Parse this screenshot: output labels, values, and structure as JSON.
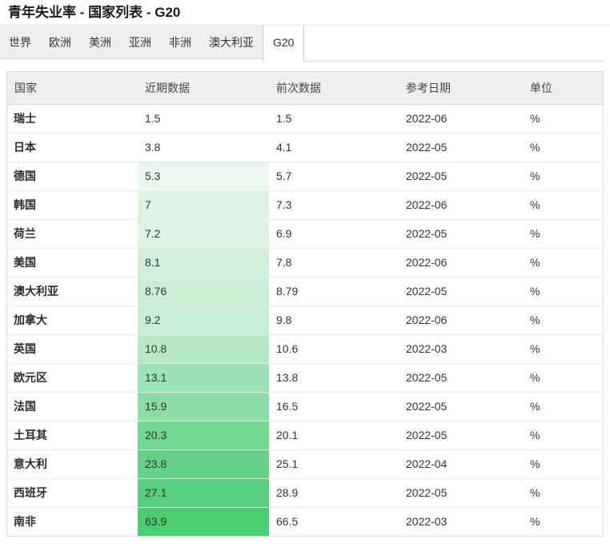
{
  "page": {
    "title": "青年失业率 - 国家列表 - G20"
  },
  "tabbar": {
    "tabs": [
      {
        "label": "世界",
        "slug": "tab-world",
        "active": false
      },
      {
        "label": "欧洲",
        "slug": "tab-europe",
        "active": false
      },
      {
        "label": "美洲",
        "slug": "tab-americas",
        "active": false
      },
      {
        "label": "亚洲",
        "slug": "tab-asia",
        "active": false
      },
      {
        "label": "非洲",
        "slug": "tab-africa",
        "active": false
      },
      {
        "label": "澳大利亚",
        "slug": "tab-australia",
        "active": false
      },
      {
        "label": "G20",
        "slug": "tab-g20",
        "active": true
      }
    ]
  },
  "table": {
    "columns": [
      "国家",
      "近期数据",
      "前次数据",
      "参考日期",
      "单位"
    ],
    "rows": [
      {
        "country": "瑞士",
        "latest": "1.5",
        "previous": "1.5",
        "date": "2022-06",
        "unit": "%",
        "highlight": null
      },
      {
        "country": "日本",
        "latest": "3.8",
        "previous": "4.1",
        "date": "2022-05",
        "unit": "%",
        "highlight": null
      },
      {
        "country": "德国",
        "latest": "5.3",
        "previous": "5.7",
        "date": "2022-05",
        "unit": "%",
        "highlight": "#e9f8ee"
      },
      {
        "country": "韩国",
        "latest": "7",
        "previous": "7.3",
        "date": "2022-06",
        "unit": "%",
        "highlight": "#def5e5"
      },
      {
        "country": "荷兰",
        "latest": "7.2",
        "previous": "6.9",
        "date": "2022-05",
        "unit": "%",
        "highlight": "#ddf5e4"
      },
      {
        "country": "美国",
        "latest": "8.1",
        "previous": "7.8",
        "date": "2022-06",
        "unit": "%",
        "highlight": "#d0f0da"
      },
      {
        "country": "澳大利亚",
        "latest": "8.76",
        "previous": "8.79",
        "date": "2022-05",
        "unit": "%",
        "highlight": "#caefd6"
      },
      {
        "country": "加拿大",
        "latest": "9.2",
        "previous": "9.8",
        "date": "2022-06",
        "unit": "%",
        "highlight": "#c7eed3"
      },
      {
        "country": "英国",
        "latest": "10.8",
        "previous": "10.6",
        "date": "2022-03",
        "unit": "%",
        "highlight": "#b7e9c7"
      },
      {
        "country": "欧元区",
        "latest": "13.1",
        "previous": "13.8",
        "date": "2022-05",
        "unit": "%",
        "highlight": "#9de2b3"
      },
      {
        "country": "法国",
        "latest": "15.9",
        "previous": "16.5",
        "date": "2022-05",
        "unit": "%",
        "highlight": "#8bdda5"
      },
      {
        "country": "土耳其",
        "latest": "20.3",
        "previous": "20.1",
        "date": "2022-05",
        "unit": "%",
        "highlight": "#73d592"
      },
      {
        "country": "意大利",
        "latest": "23.8",
        "previous": "25.1",
        "date": "2022-04",
        "unit": "%",
        "highlight": "#64d187"
      },
      {
        "country": "西班牙",
        "latest": "27.1",
        "previous": "28.9",
        "date": "2022-05",
        "unit": "%",
        "highlight": "#58cf7e"
      },
      {
        "country": "南非",
        "latest": "63.9",
        "previous": "66.5",
        "date": "2022-03",
        "unit": "%",
        "highlight": "#4ace6f"
      }
    ]
  },
  "colors": {
    "heat_green_max": "#4ace6f",
    "table_header_bg": "#efefef",
    "tabbar_bg": "#efefef"
  }
}
